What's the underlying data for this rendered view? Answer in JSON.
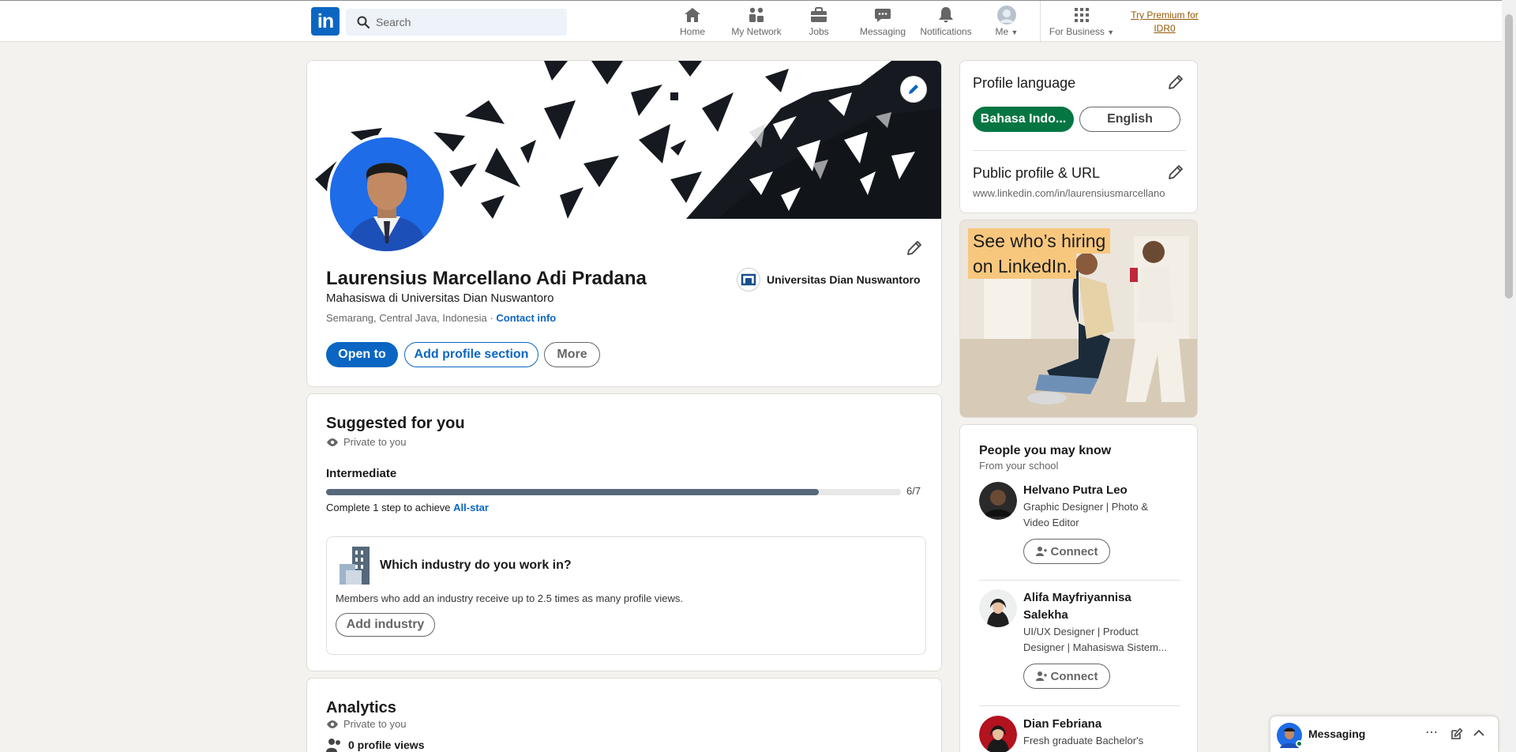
{
  "nav": {
    "search_placeholder": "Search",
    "items": [
      {
        "label": "Home",
        "icon": "home-icon"
      },
      {
        "label": "My Network",
        "icon": "network-icon"
      },
      {
        "label": "Jobs",
        "icon": "jobs-icon"
      },
      {
        "label": "Messaging",
        "icon": "messaging-icon"
      },
      {
        "label": "Notifications",
        "icon": "bell-icon"
      },
      {
        "label": "Me",
        "icon": "avatar"
      },
      {
        "label": "For Business",
        "icon": "grid-icon"
      }
    ],
    "premium_line1": "Try Premium for",
    "premium_line2": "IDR0",
    "logo": "in"
  },
  "profile": {
    "name": "Laurensius Marcellano Adi Pradana",
    "headline": "Mahasiswa di Universitas Dian Nuswantoro",
    "location": "Semarang, Central Java, Indonesia",
    "separator": "·",
    "contact_info": "Contact info",
    "school": "Universitas Dian Nuswantoro",
    "btn_open_to": "Open to",
    "btn_add_section": "Add profile section",
    "btn_more": "More"
  },
  "suggested": {
    "title": "Suggested for you",
    "private": "Private to you",
    "level": "Intermediate",
    "progress_text": "6/7",
    "progress_fraction": 0.857,
    "complete_prefix": "Complete 1 step to achieve ",
    "complete_link": "All-star",
    "industry_q": "Which industry do you work in?",
    "industry_desc": "Members who add an industry receive up to 2.5 times as many profile views.",
    "btn_add_industry": "Add industry"
  },
  "analytics": {
    "title": "Analytics",
    "private": "Private to you",
    "profile_views": "0 profile views"
  },
  "right": {
    "lang_title": "Profile language",
    "lang_active": "Bahasa Indo...",
    "lang_other": "English",
    "url_title": "Public profile & URL",
    "url": "www.linkedin.com/in/laurensiusmarcellano",
    "ad_line1": "See who’s hiring",
    "ad_line2": "on LinkedIn.",
    "pymk_title": "People you may know",
    "pymk_sub": "From your school",
    "connect_label": "Connect",
    "people": [
      {
        "name": "Helvano Putra Leo",
        "desc1": "Graphic Designer | Photo &",
        "desc2": "Video Editor"
      },
      {
        "name1": "Alifa Mayfriyannisa",
        "name2": "Salekha",
        "desc1": "UI/UX Designer | Product",
        "desc2": "Designer | Mahasiswa Sistem..."
      },
      {
        "name": "Dian Febriana",
        "desc1": "Fresh graduate Bachelor's"
      }
    ]
  },
  "messaging": {
    "label": "Messaging"
  },
  "colors": {
    "brand": "#0a66c2",
    "lang_active": "#057642",
    "premium": "#915907"
  }
}
